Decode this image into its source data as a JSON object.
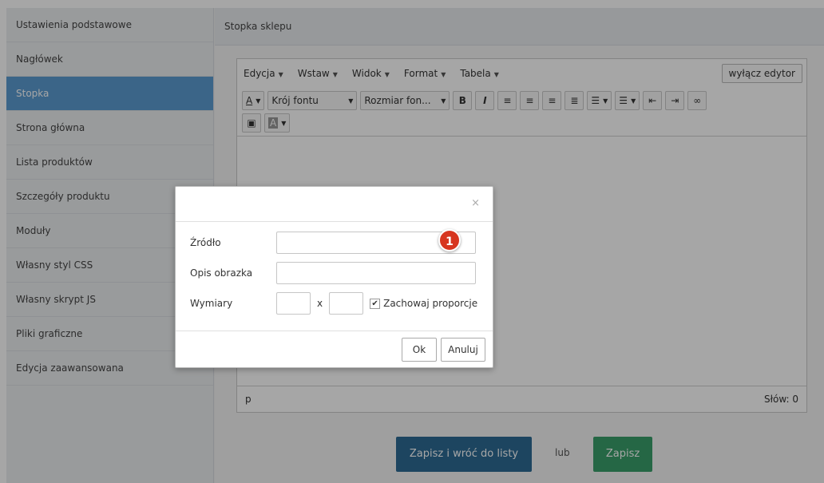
{
  "sidebar": {
    "items": [
      {
        "label": "Ustawienia podstawowe"
      },
      {
        "label": "Nagłówek"
      },
      {
        "label": "Stopka"
      },
      {
        "label": "Strona główna"
      },
      {
        "label": "Lista produktów"
      },
      {
        "label": "Szczegóły produktu"
      },
      {
        "label": "Moduły"
      },
      {
        "label": "Własny styl CSS"
      },
      {
        "label": "Własny skrypt JS"
      },
      {
        "label": "Pliki graficzne"
      },
      {
        "label": "Edycja zaawansowana"
      }
    ],
    "active_index": 2
  },
  "main": {
    "title": "Stopka sklepu",
    "save_back_label": "Zapisz i wróć do listy",
    "or_label": "lub",
    "save_label": "Zapisz"
  },
  "editor": {
    "menu": [
      "Edycja",
      "Wstaw",
      "Widok",
      "Format",
      "Tabela"
    ],
    "toggle_label": "wyłącz edytor",
    "font_family_label": "Krój fontu",
    "font_size_label": "Rozmiar fon...",
    "text_color_label": "A",
    "bg_color_label": "A",
    "bold_label": "B",
    "italic_label": "I",
    "path_label": "p",
    "word_count": "Słów: 0"
  },
  "dialog": {
    "close_glyph": "×",
    "source_label": "Źródło",
    "source_value": "",
    "description_label": "Opis obrazka",
    "description_value": "",
    "dimensions_label": "Wymiary",
    "width_value": "",
    "x_label": "x",
    "height_value": "",
    "keep_ratio_label": "Zachowaj proporcje",
    "keep_ratio_checked": true,
    "ok_label": "Ok",
    "cancel_label": "Anuluj"
  },
  "annotation": {
    "badge": "1"
  },
  "colors": {
    "active_sidebar": "#5b9bd1",
    "save_back_button": "#2d6b94",
    "save_button": "#3a9e6a",
    "badge": "#d7351f"
  }
}
